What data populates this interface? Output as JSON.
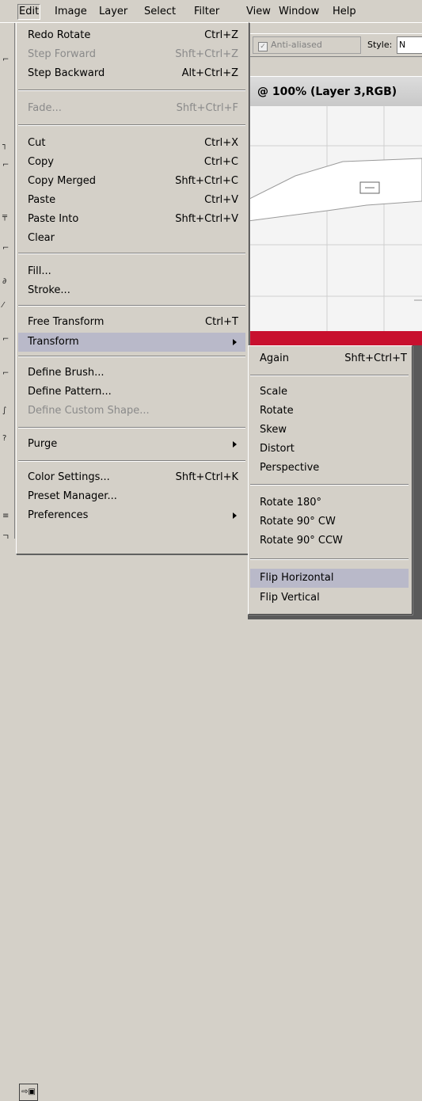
{
  "menubar": {
    "items": [
      {
        "label": "Edit"
      },
      {
        "label": "Image"
      },
      {
        "label": "Layer"
      },
      {
        "label": "Select"
      },
      {
        "label": "Filter"
      },
      {
        "label": "View"
      },
      {
        "label": "Window"
      },
      {
        "label": "Help"
      }
    ]
  },
  "options": {
    "antialias_label": "Anti-aliased",
    "antialias_checked": true,
    "style_label": "Style:",
    "style_value": "N"
  },
  "document": {
    "title": "@ 100% (Layer 3,RGB)"
  },
  "edit_menu": {
    "items": [
      {
        "label": "Redo Rotate",
        "shortcut": "Ctrl+Z",
        "disabled": false
      },
      {
        "label": "Step Forward",
        "shortcut": "Shft+Ctrl+Z",
        "disabled": true
      },
      {
        "label": "Step Backward",
        "shortcut": "Alt+Ctrl+Z",
        "disabled": false
      },
      {
        "label": "Fade...",
        "shortcut": "Shft+Ctrl+F",
        "disabled": true
      },
      {
        "label": "Cut",
        "shortcut": "Ctrl+X",
        "disabled": false
      },
      {
        "label": "Copy",
        "shortcut": "Ctrl+C",
        "disabled": false
      },
      {
        "label": "Copy Merged",
        "shortcut": "Shft+Ctrl+C",
        "disabled": false
      },
      {
        "label": "Paste",
        "shortcut": "Ctrl+V",
        "disabled": false
      },
      {
        "label": "Paste Into",
        "shortcut": "Shft+Ctrl+V",
        "disabled": false
      },
      {
        "label": "Clear",
        "shortcut": "",
        "disabled": false
      },
      {
        "label": "Fill...",
        "shortcut": "",
        "disabled": false
      },
      {
        "label": "Stroke...",
        "shortcut": "",
        "disabled": false
      },
      {
        "label": "Free Transform",
        "shortcut": "Ctrl+T",
        "disabled": false
      },
      {
        "label": "Transform",
        "shortcut": "",
        "disabled": false,
        "submenu": true
      },
      {
        "label": "Define Brush...",
        "shortcut": "",
        "disabled": false
      },
      {
        "label": "Define Pattern...",
        "shortcut": "",
        "disabled": false
      },
      {
        "label": "Define Custom Shape...",
        "shortcut": "",
        "disabled": true
      },
      {
        "label": "Purge",
        "shortcut": "",
        "disabled": false,
        "submenu": true
      },
      {
        "label": "Color Settings...",
        "shortcut": "Shft+Ctrl+K",
        "disabled": false
      },
      {
        "label": "Preset Manager...",
        "shortcut": "",
        "disabled": false
      },
      {
        "label": "Preferences",
        "shortcut": "",
        "disabled": false,
        "submenu": true
      }
    ]
  },
  "transform_menu": {
    "items": [
      {
        "label": "Again",
        "shortcut": "Shft+Ctrl+T"
      },
      {
        "label": "Scale",
        "shortcut": ""
      },
      {
        "label": "Rotate",
        "shortcut": ""
      },
      {
        "label": "Skew",
        "shortcut": ""
      },
      {
        "label": "Distort",
        "shortcut": ""
      },
      {
        "label": "Perspective",
        "shortcut": ""
      },
      {
        "label": "Rotate 180°",
        "shortcut": ""
      },
      {
        "label": "Rotate 90° CW",
        "shortcut": ""
      },
      {
        "label": "Rotate 90° CCW",
        "shortcut": ""
      },
      {
        "label": "Flip Horizontal",
        "shortcut": ""
      },
      {
        "label": "Flip Vertical",
        "shortcut": ""
      }
    ]
  },
  "colors": {
    "menu_bg": "#d4d0c8",
    "highlight": "#b9b9c9",
    "disabled_text": "#8a8a8a",
    "red_strip": "#c8102e"
  }
}
